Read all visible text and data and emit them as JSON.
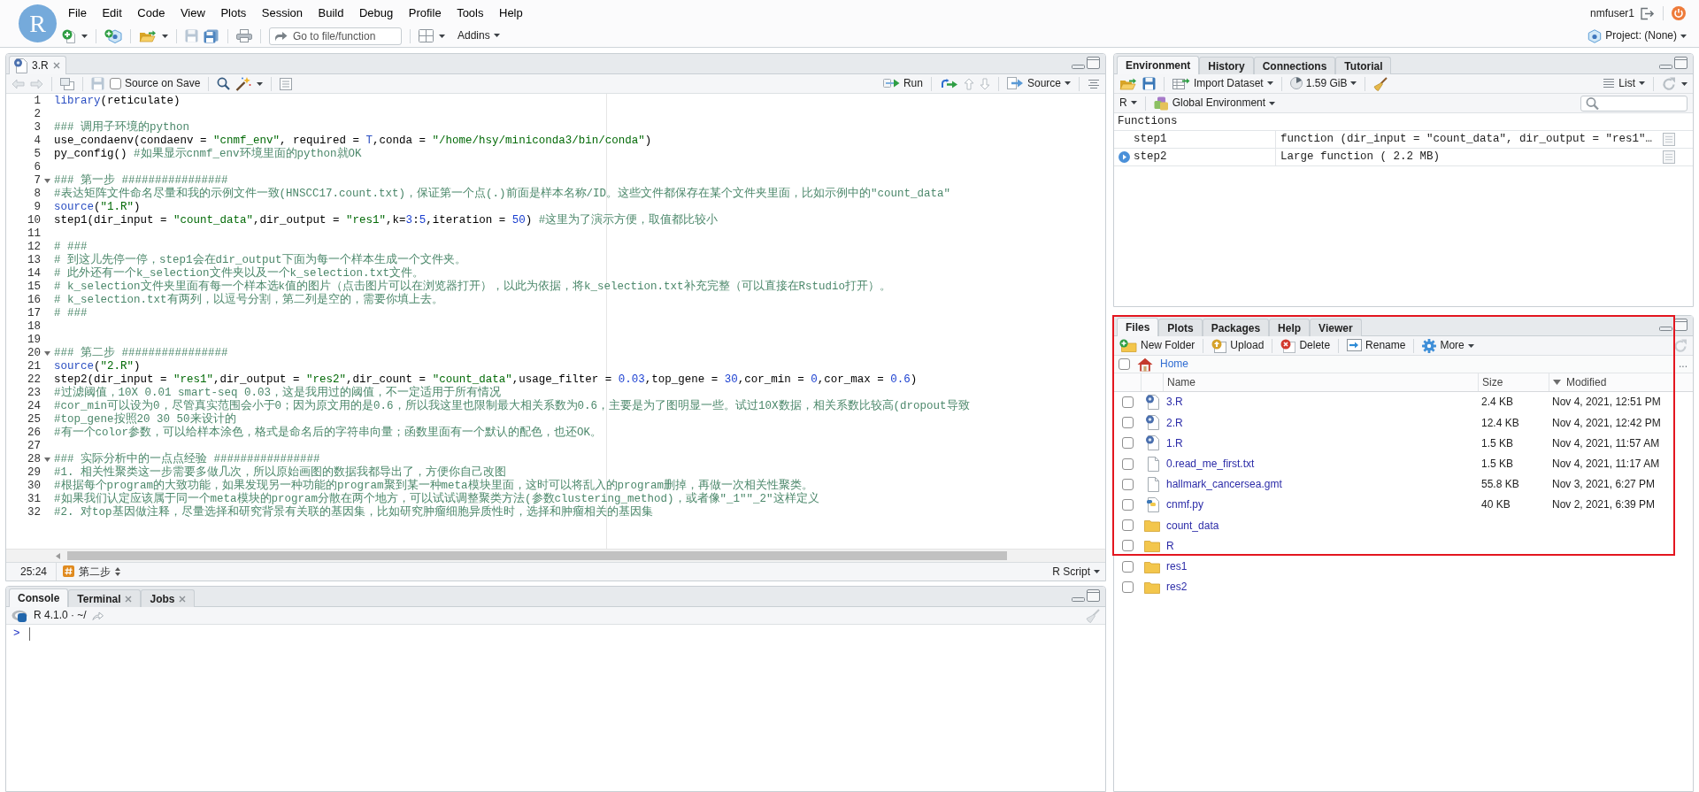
{
  "app": {
    "logo": "R",
    "menu": [
      "File",
      "Edit",
      "Code",
      "View",
      "Plots",
      "Session",
      "Build",
      "Debug",
      "Profile",
      "Tools",
      "Help"
    ],
    "user": "nmfuser1",
    "goto_placeholder": "Go to file/function",
    "addins": "Addins",
    "project": "Project: (None)"
  },
  "editor": {
    "tabs": [
      {
        "label": "3.R",
        "selected": true
      }
    ],
    "source_on_save": {
      "label": "Source on Save",
      "checked": false
    },
    "run": "Run",
    "source": "Source",
    "lines": [
      {
        "number": "1",
        "foldable": false,
        "segments": [
          {
            "text": "library",
            "kind": "call"
          },
          {
            "text": "(reticulate)",
            "kind": "plain"
          }
        ]
      },
      {
        "number": "2",
        "foldable": false
      },
      {
        "number": "3",
        "foldable": false,
        "segments": [
          {
            "text": "### 调用子环境的python",
            "kind": "comment"
          }
        ]
      },
      {
        "number": "4",
        "foldable": false,
        "segments": [
          {
            "text": "use_condaenv(condaenv = ",
            "kind": "plain"
          },
          {
            "text": "\"cnmf_env\"",
            "kind": "string"
          },
          {
            "text": ", required = ",
            "kind": "plain"
          },
          {
            "text": "T",
            "kind": "keyword"
          },
          {
            "text": ",conda = ",
            "kind": "plain"
          },
          {
            "text": "\"/home/hsy/miniconda3/bin/conda\"",
            "kind": "string"
          },
          {
            "text": ")",
            "kind": "plain"
          }
        ]
      },
      {
        "number": "5",
        "foldable": false,
        "segments": [
          {
            "text": "py_config() ",
            "kind": "plain"
          },
          {
            "text": "#如果显示cnmf_env环境里面的python就OK",
            "kind": "comment"
          }
        ]
      },
      {
        "number": "6",
        "foldable": false
      },
      {
        "number": "7",
        "foldable": true,
        "segments": [
          {
            "text": "### 第一步 ################",
            "kind": "comment"
          }
        ]
      },
      {
        "number": "8",
        "foldable": false,
        "segments": [
          {
            "text": "#表达矩阵文件命名尽量和我的示例文件一致(HNSCC17.count.txt)，保证第一个点(.)前面是样本名称/ID。这些文件都保存在某个文件夹里面，比如示例中的\"count_data\"",
            "kind": "comment"
          }
        ]
      },
      {
        "number": "9",
        "foldable": false,
        "segments": [
          {
            "text": "source",
            "kind": "call"
          },
          {
            "text": "(",
            "kind": "plain"
          },
          {
            "text": "\"1.R\"",
            "kind": "string"
          },
          {
            "text": ")",
            "kind": "plain"
          }
        ]
      },
      {
        "number": "10",
        "foldable": false,
        "segments": [
          {
            "text": "step1(dir_input = ",
            "kind": "plain"
          },
          {
            "text": "\"count_data\"",
            "kind": "string"
          },
          {
            "text": ",dir_output = ",
            "kind": "plain"
          },
          {
            "text": "\"res1\"",
            "kind": "string"
          },
          {
            "text": ",k=",
            "kind": "plain"
          },
          {
            "text": "3",
            "kind": "number"
          },
          {
            "text": ":",
            "kind": "plain"
          },
          {
            "text": "5",
            "kind": "number"
          },
          {
            "text": ",iteration = ",
            "kind": "plain"
          },
          {
            "text": "50",
            "kind": "number"
          },
          {
            "text": ") ",
            "kind": "plain"
          },
          {
            "text": "#这里为了演示方便，取值都比较小",
            "kind": "comment"
          }
        ]
      },
      {
        "number": "11",
        "foldable": false
      },
      {
        "number": "12",
        "foldable": false,
        "segments": [
          {
            "text": "# ###",
            "kind": "comment"
          }
        ]
      },
      {
        "number": "13",
        "foldable": false,
        "segments": [
          {
            "text": "# 到这儿先停一停，step1会在dir_output下面为每一个样本生成一个文件夹。",
            "kind": "comment"
          }
        ]
      },
      {
        "number": "14",
        "foldable": false,
        "segments": [
          {
            "text": "# 此外还有一个k_selection文件夹以及一个k_selection.txt文件。",
            "kind": "comment"
          }
        ]
      },
      {
        "number": "15",
        "foldable": false,
        "segments": [
          {
            "text": "# k_selection文件夹里面有每一个样本选k值的图片（点击图片可以在浏览器打开），以此为依据，将k_selection.txt补充完整（可以直接在Rstudio打开）。",
            "kind": "comment"
          }
        ]
      },
      {
        "number": "16",
        "foldable": false,
        "segments": [
          {
            "text": "# k_selection.txt有两列，以逗号分割，第二列是空的，需要你填上去。",
            "kind": "comment"
          }
        ]
      },
      {
        "number": "17",
        "foldable": false,
        "segments": [
          {
            "text": "# ###",
            "kind": "comment"
          }
        ]
      },
      {
        "number": "18",
        "foldable": false
      },
      {
        "number": "19",
        "foldable": false
      },
      {
        "number": "20",
        "foldable": true,
        "segments": [
          {
            "text": "### 第二步 ################",
            "kind": "comment"
          }
        ]
      },
      {
        "number": "21",
        "foldable": false,
        "segments": [
          {
            "text": "source",
            "kind": "call"
          },
          {
            "text": "(",
            "kind": "plain"
          },
          {
            "text": "\"2.R\"",
            "kind": "string"
          },
          {
            "text": ")",
            "kind": "plain"
          }
        ]
      },
      {
        "number": "22",
        "foldable": false,
        "segments": [
          {
            "text": "step2(dir_input = ",
            "kind": "plain"
          },
          {
            "text": "\"res1\"",
            "kind": "string"
          },
          {
            "text": ",dir_output = ",
            "kind": "plain"
          },
          {
            "text": "\"res2\"",
            "kind": "string"
          },
          {
            "text": ",dir_count = ",
            "kind": "plain"
          },
          {
            "text": "\"count_data\"",
            "kind": "string"
          },
          {
            "text": ",usage_filter = ",
            "kind": "plain"
          },
          {
            "text": "0.03",
            "kind": "number"
          },
          {
            "text": ",top_gene = ",
            "kind": "plain"
          },
          {
            "text": "30",
            "kind": "number"
          },
          {
            "text": ",cor_min = ",
            "kind": "plain"
          },
          {
            "text": "0",
            "kind": "number"
          },
          {
            "text": ",cor_max = ",
            "kind": "plain"
          },
          {
            "text": "0.6",
            "kind": "number"
          },
          {
            "text": ")",
            "kind": "plain"
          }
        ]
      },
      {
        "number": "23",
        "foldable": false,
        "segments": [
          {
            "text": "#过滤阈值，10X 0.01 smart-seq 0.03，这是我用过的阈值，不一定适用于所有情况",
            "kind": "comment"
          }
        ]
      },
      {
        "number": "24",
        "foldable": false,
        "segments": [
          {
            "text": "#cor_min可以设为0，尽管真实范围会小于0；因为原文用的是0.6，所以我这里也限制最大相关系数为0.6，主要是为了图明显一些。试过10X数据，相关系数比较高(dropout导致",
            "kind": "comment"
          }
        ]
      },
      {
        "number": "25",
        "foldable": false,
        "segments": [
          {
            "text": "#top_gene按照20 30 50来设计的",
            "kind": "comment"
          }
        ]
      },
      {
        "number": "26",
        "foldable": false,
        "segments": [
          {
            "text": "#有一个color参数，可以给样本涂色，格式是命名后的字符串向量；函数里面有一个默认的配色，也还OK。",
            "kind": "comment"
          }
        ]
      },
      {
        "number": "27",
        "foldable": false
      },
      {
        "number": "28",
        "foldable": true,
        "segments": [
          {
            "text": "### 实际分析中的一点点经验 ################",
            "kind": "comment"
          }
        ]
      },
      {
        "number": "29",
        "foldable": false,
        "segments": [
          {
            "text": "#1. 相关性聚类这一步需要多做几次，所以原始画图的数据我都导出了，方便你自己改图",
            "kind": "comment"
          }
        ]
      },
      {
        "number": "30",
        "foldable": false,
        "segments": [
          {
            "text": "#根据每个program的大致功能，如果发现另一种功能的program聚到某一种meta模块里面，这时可以将乱入的program删掉，再做一次相关性聚类。",
            "kind": "comment"
          }
        ]
      },
      {
        "number": "31",
        "foldable": false,
        "segments": [
          {
            "text": "#如果我们认定应该属于同一个meta模块的program分散在两个地方，可以试试调整聚类方法(参数clustering_method)，或者像\"_1\"\"_2\"这样定义",
            "kind": "comment"
          }
        ]
      },
      {
        "number": "32",
        "foldable": false,
        "segments": [
          {
            "text": "#2. 对top基因做注释，尽量选择和研究背景有关联的基因集，比如研究肿瘤细胞异质性时，选择和肿瘤相关的基因集",
            "kind": "comment"
          }
        ]
      }
    ],
    "status": {
      "position": "25:24",
      "section": "第二步",
      "file_type": "R Script"
    }
  },
  "console": {
    "tabs": [
      {
        "label": "Console",
        "selected": true,
        "closable": false
      },
      {
        "label": "Terminal",
        "selected": false,
        "closable": true
      },
      {
        "label": "Jobs",
        "selected": false,
        "closable": true
      }
    ],
    "session": "R 4.1.0 · ~/",
    "prompt": ">"
  },
  "environment": {
    "tabs": [
      {
        "label": "Environment",
        "selected": true
      },
      {
        "label": "History",
        "selected": false
      },
      {
        "label": "Connections",
        "selected": false
      },
      {
        "label": "Tutorial",
        "selected": false
      }
    ],
    "import_dataset": "Import Dataset",
    "memory": "1.59 GiB",
    "view": "List",
    "language": "R",
    "scope": "Global Environment",
    "section": "Functions",
    "rows": [
      {
        "name": "step1",
        "value": "function (dir_input = \"count_data\", dir_output = \"res1\"…",
        "expandable": false
      },
      {
        "name": "step2",
        "value": "Large function ( 2.2 MB)",
        "expandable": true
      }
    ]
  },
  "files": {
    "tabs": [
      {
        "label": "Files",
        "selected": true
      },
      {
        "label": "Plots",
        "selected": false
      },
      {
        "label": "Packages",
        "selected": false
      },
      {
        "label": "Help",
        "selected": false
      },
      {
        "label": "Viewer",
        "selected": false
      }
    ],
    "actions": [
      {
        "label": "New Folder",
        "kind": "new-folder"
      },
      {
        "label": "Upload",
        "kind": "upload"
      },
      {
        "label": "Delete",
        "kind": "delete"
      },
      {
        "label": "Rename",
        "kind": "rename"
      },
      {
        "label": "More",
        "kind": "more"
      }
    ],
    "select_all": false,
    "path": "Home",
    "more": "...",
    "columns": [
      {
        "label": "Name",
        "sorted": false
      },
      {
        "label": "Size",
        "sorted": false
      },
      {
        "label": "Modified",
        "sorted": true
      }
    ],
    "rows": [
      {
        "name": "3.R",
        "size": "2.4 KB",
        "modified": "Nov 4, 2021, 12:51 PM",
        "kind": "r-script",
        "checked": false
      },
      {
        "name": "2.R",
        "size": "12.4 KB",
        "modified": "Nov 4, 2021, 12:42 PM",
        "kind": "r-script",
        "checked": false
      },
      {
        "name": "1.R",
        "size": "1.5 KB",
        "modified": "Nov 4, 2021, 11:57 AM",
        "kind": "r-script",
        "checked": false
      },
      {
        "name": "0.read_me_first.txt",
        "size": "1.5 KB",
        "modified": "Nov 4, 2021, 11:17 AM",
        "kind": "text",
        "checked": false
      },
      {
        "name": "hallmark_cancersea.gmt",
        "size": "55.8 KB",
        "modified": "Nov 3, 2021, 6:27 PM",
        "kind": "text",
        "checked": false
      },
      {
        "name": "cnmf.py",
        "size": "40 KB",
        "modified": "Nov 2, 2021, 6:39 PM",
        "kind": "python",
        "checked": false
      },
      {
        "name": "count_data",
        "kind": "folder",
        "checked": false
      },
      {
        "name": "R",
        "kind": "folder",
        "checked": false
      },
      {
        "name": "res1",
        "kind": "folder",
        "checked": false
      },
      {
        "name": "res2",
        "kind": "folder",
        "checked": false
      }
    ]
  }
}
